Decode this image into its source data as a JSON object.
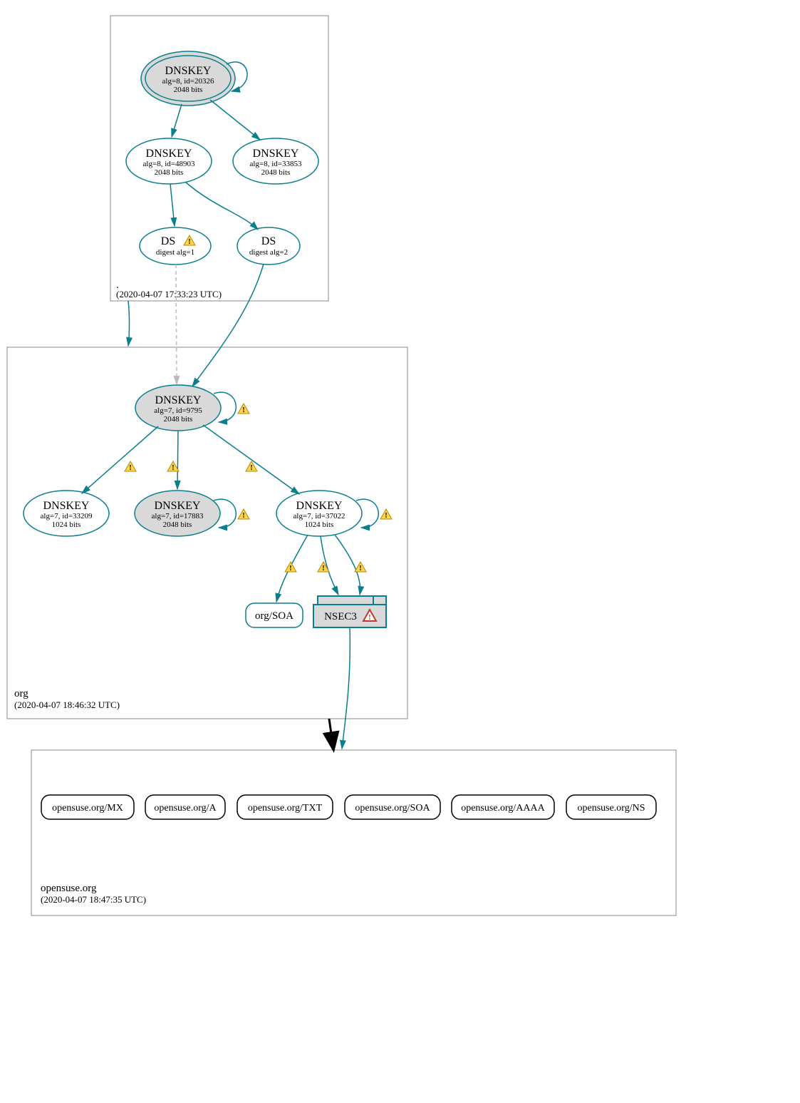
{
  "zones": {
    "root": {
      "name": ".",
      "timestamp": "(2020-04-07 17:33:23 UTC)"
    },
    "org": {
      "name": "org",
      "timestamp": "(2020-04-07 18:46:32 UTC)"
    },
    "opensuse": {
      "name": "opensuse.org",
      "timestamp": "(2020-04-07 18:47:35 UTC)"
    }
  },
  "nodes": {
    "root_ksk": {
      "title": "DNSKEY",
      "line2": "alg=8, id=20326",
      "line3": "2048 bits"
    },
    "root_zsk1": {
      "title": "DNSKEY",
      "line2": "alg=8, id=48903",
      "line3": "2048 bits"
    },
    "root_zsk2": {
      "title": "DNSKEY",
      "line2": "alg=8, id=33853",
      "line3": "2048 bits"
    },
    "ds1": {
      "title": "DS",
      "line2": "digest alg=1"
    },
    "ds2": {
      "title": "DS",
      "line2": "digest alg=2"
    },
    "org_ksk": {
      "title": "DNSKEY",
      "line2": "alg=7, id=9795",
      "line3": "2048 bits"
    },
    "org_k1": {
      "title": "DNSKEY",
      "line2": "alg=7, id=33209",
      "line3": "1024 bits"
    },
    "org_k2": {
      "title": "DNSKEY",
      "line2": "alg=7, id=17883",
      "line3": "2048 bits"
    },
    "org_k3": {
      "title": "DNSKEY",
      "line2": "alg=7, id=37022",
      "line3": "1024 bits"
    },
    "org_soa": {
      "title": "org/SOA"
    },
    "nsec3": {
      "title": "NSEC3"
    },
    "rec_mx": {
      "title": "opensuse.org/MX"
    },
    "rec_a": {
      "title": "opensuse.org/A"
    },
    "rec_txt": {
      "title": "opensuse.org/TXT"
    },
    "rec_soa": {
      "title": "opensuse.org/SOA"
    },
    "rec_aaaa": {
      "title": "opensuse.org/AAAA"
    },
    "rec_ns": {
      "title": "opensuse.org/NS"
    }
  }
}
